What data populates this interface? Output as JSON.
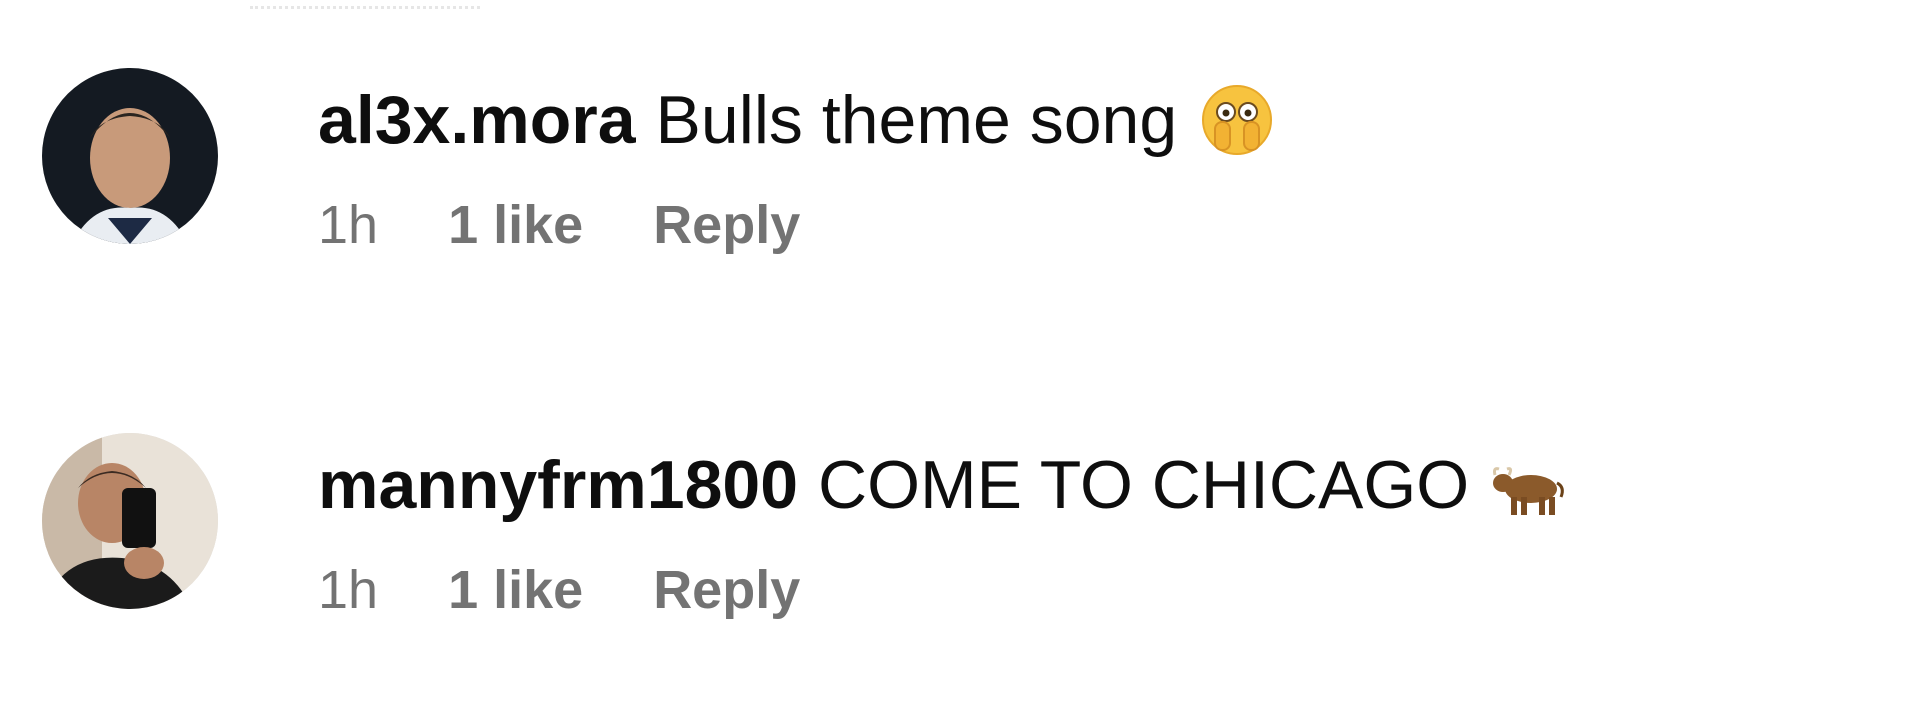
{
  "comments": [
    {
      "username": "al3x.mora",
      "text": "Bulls theme song",
      "emoji": "face-with-open-eyes-and-hand-over-mouth",
      "time": "1h",
      "likes": "1 like",
      "reply_label": "Reply"
    },
    {
      "username": "mannyfrm1800",
      "text": "COME TO CHICAGO",
      "emoji": "ox",
      "time": "1h",
      "likes": "1 like",
      "reply_label": "Reply"
    }
  ],
  "colors": {
    "text_primary": "#0e0e0e",
    "text_secondary": "#737373",
    "background": "#ffffff"
  }
}
